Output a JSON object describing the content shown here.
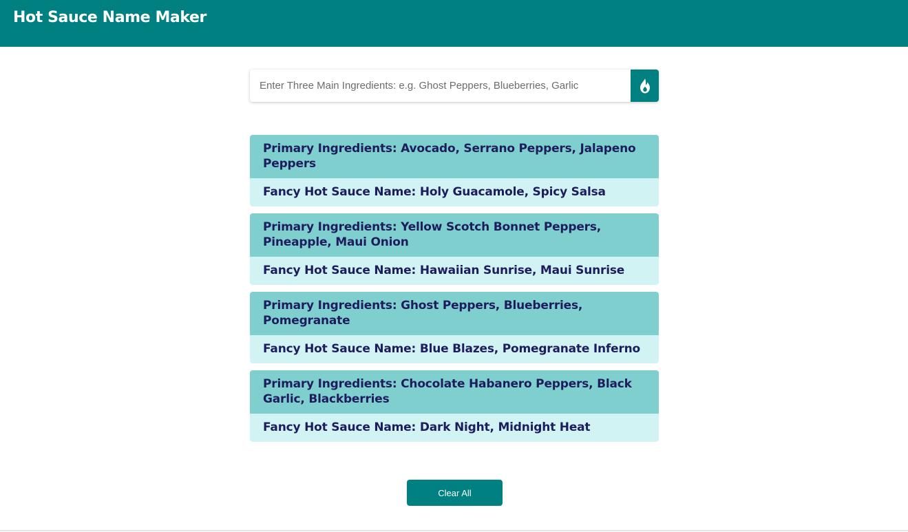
{
  "header": {
    "title": "Hot Sauce Name Maker",
    "background": "#008080"
  },
  "search": {
    "placeholder": "Enter Three Main Ingredients: e.g. Ghost Peppers, Blueberries, Garlic",
    "value": "",
    "button_icon": "flame-icon"
  },
  "results": [
    {
      "ingredients": "Primary Ingredients: Avocado, Serrano Peppers, Jalapeno Peppers",
      "name": "Fancy Hot Sauce Name: Holy Guacamole, Spicy Salsa"
    },
    {
      "ingredients": "Primary Ingredients: Yellow Scotch Bonnet Peppers, Pineapple, Maui Onion",
      "name": "Fancy Hot Sauce Name: Hawaiian Sunrise, Maui Sunrise"
    },
    {
      "ingredients": "Primary Ingredients: Ghost Peppers, Blueberries, Pomegranate",
      "name": "Fancy Hot Sauce Name: Blue Blazes, Pomegranate Inferno"
    },
    {
      "ingredients": "Primary Ingredients: Chocolate Habanero Peppers, Black Garlic, Blackberries",
      "name": "Fancy Hot Sauce Name: Dark Night, Midnight Heat"
    }
  ],
  "actions": {
    "clear_label": "Clear All"
  },
  "colors": {
    "accent": "#008080",
    "card_header": "#80cfcf",
    "card_body": "#d2f3f3",
    "card_text": "#1d1d5e"
  }
}
